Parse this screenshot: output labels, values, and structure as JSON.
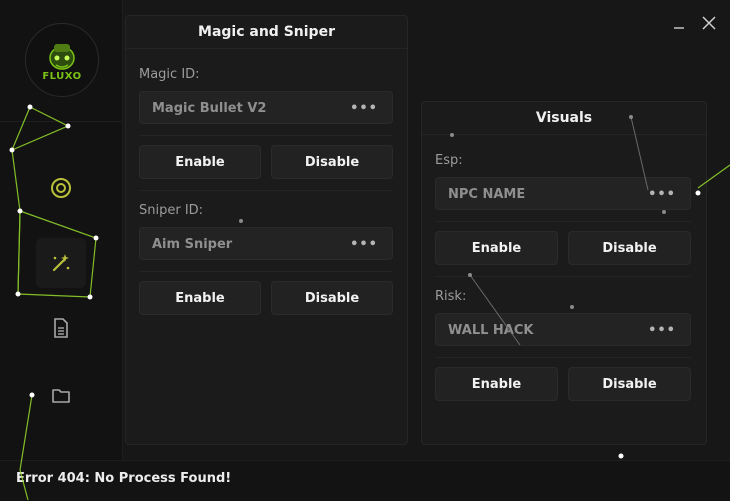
{
  "app": {
    "logo_text": "FLUXO"
  },
  "sidebar": {
    "items": [
      {
        "icon": "target-icon"
      },
      {
        "icon": "magic-wand-icon"
      },
      {
        "icon": "document-icon"
      },
      {
        "icon": "folder-icon"
      }
    ]
  },
  "window": {
    "minimize_label": "_",
    "close_label": "✕"
  },
  "magic_panel": {
    "title": "Magic and Sniper",
    "magic_label": "Magic ID:",
    "magic_value": "Magic Bullet V2",
    "enable_1": "Enable",
    "disable_1": "Disable",
    "sniper_label": "Sniper ID:",
    "sniper_value": "Aim Sniper",
    "enable_2": "Enable",
    "disable_2": "Disable"
  },
  "visuals_panel": {
    "title": "Visuals",
    "esp_label": "Esp:",
    "esp_value": "NPC NAME",
    "enable_1": "Enable",
    "disable_1": "Disable",
    "risk_label": "Risk:",
    "risk_value": "WALL HACK",
    "enable_2": "Enable",
    "disable_2": "Disable"
  },
  "more_label": "•••",
  "status": {
    "text": "Error 404: No Process Found!"
  },
  "colors": {
    "accent": "#8fd12a",
    "particle": "#ffffff"
  }
}
